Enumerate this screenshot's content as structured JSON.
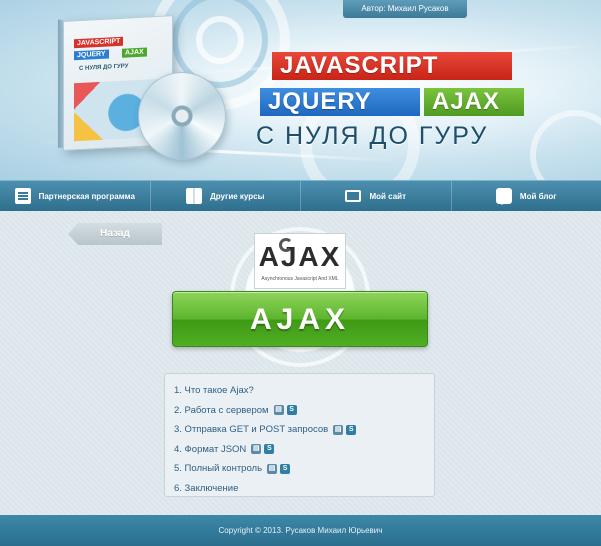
{
  "header": {
    "author": "Автор: Михаил Русаков",
    "title_line1": "JAVASCRIPT",
    "title_jquery": "JQUERY",
    "title_ajax": "AJAX",
    "subtitle": "С НУЛЯ ДО ГУРУ",
    "box_labels": [
      "JAVASCRIPT",
      "JQUERY",
      "AJAX",
      "С НУЛЯ ДО ГУРУ"
    ]
  },
  "nav": {
    "items": [
      {
        "label": "Партнерская программа",
        "icon": "document-icon"
      },
      {
        "label": "Другие курсы",
        "icon": "book-icon"
      },
      {
        "label": "Мой сайт",
        "icon": "monitor-icon"
      },
      {
        "label": "Мой блог",
        "icon": "chat-icon"
      }
    ]
  },
  "main": {
    "back_label": "Назад",
    "logo_text": "AJAX",
    "logo_caption": "Asynchronous Javascript And XML",
    "section_button": "AJAX",
    "lessons": [
      {
        "text": "1. Что такое Ajax?",
        "badges": []
      },
      {
        "text": "2. Работа с сервером",
        "badges": [
          "doc",
          "S"
        ]
      },
      {
        "text": "3. Отправка GET и POST запросов",
        "badges": [
          "doc",
          "S"
        ]
      },
      {
        "text": "4. Формат JSON",
        "badges": [
          "doc",
          "S"
        ]
      },
      {
        "text": "5. Полный контроль",
        "badges": [
          "doc",
          "S"
        ]
      },
      {
        "text": "6. Заключение",
        "badges": []
      }
    ]
  },
  "footer": {
    "copyright": "Copyright © 2013. Русаков Михаил Юрьевич"
  },
  "colors": {
    "nav_bg": "#3a7f9f",
    "green_button": "#5cb52d",
    "red": "#d9312a",
    "blue": "#2a7fd4",
    "green": "#4ea72c"
  }
}
